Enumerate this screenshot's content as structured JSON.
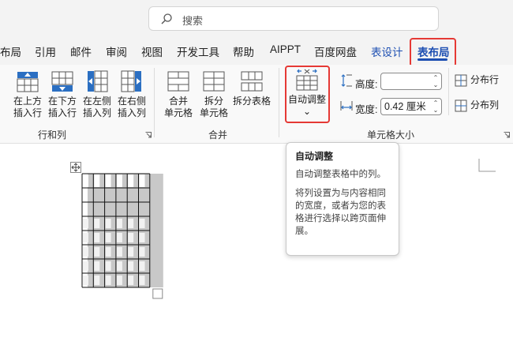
{
  "search": {
    "placeholder": "搜索"
  },
  "tabs": [
    {
      "label": "布局"
    },
    {
      "label": "引用"
    },
    {
      "label": "邮件"
    },
    {
      "label": "审阅"
    },
    {
      "label": "视图"
    },
    {
      "label": "开发工具"
    },
    {
      "label": "帮助"
    },
    {
      "label": "AIPPT"
    },
    {
      "label": "百度网盘"
    },
    {
      "label": "表设计"
    },
    {
      "label": "表布局"
    }
  ],
  "groups": {
    "rows_cols": {
      "label": "行和列",
      "buttons": [
        {
          "line1": "在上方",
          "line2": "插入行",
          "icon": "insert-row-above-icon"
        },
        {
          "line1": "在下方",
          "line2": "插入行",
          "icon": "insert-row-below-icon"
        },
        {
          "line1": "在左侧",
          "line2": "插入列",
          "icon": "insert-col-left-icon"
        },
        {
          "line1": "在右侧",
          "line2": "插入列",
          "icon": "insert-col-right-icon"
        }
      ]
    },
    "merge": {
      "label": "合并",
      "buttons": [
        {
          "line1": "合并",
          "line2": "单元格",
          "icon": "merge-cells-icon"
        },
        {
          "line1": "拆分",
          "line2": "单元格",
          "icon": "split-cells-icon"
        },
        {
          "line1": "拆分表格",
          "line2": "",
          "icon": "split-table-icon"
        }
      ]
    },
    "cell_size": {
      "label": "单元格大小",
      "autofit": {
        "label": "自动调整",
        "caret": "⌄"
      },
      "height": {
        "label": "高度:",
        "value": ""
      },
      "width": {
        "label": "宽度:",
        "value": "0.42 厘米"
      },
      "distribute_rows": "分布行",
      "distribute_cols": "分布列"
    }
  },
  "tooltip": {
    "title": "自动调整",
    "line1": "自动调整表格中的列。",
    "line2": "将列设置为与内容相同的宽度，或者为您的表格进行选择以跨页面伸展。"
  },
  "colors": {
    "accent": "#1d4fb2",
    "highlight": "#e53935",
    "icon_blue": "#2b6fc2"
  }
}
